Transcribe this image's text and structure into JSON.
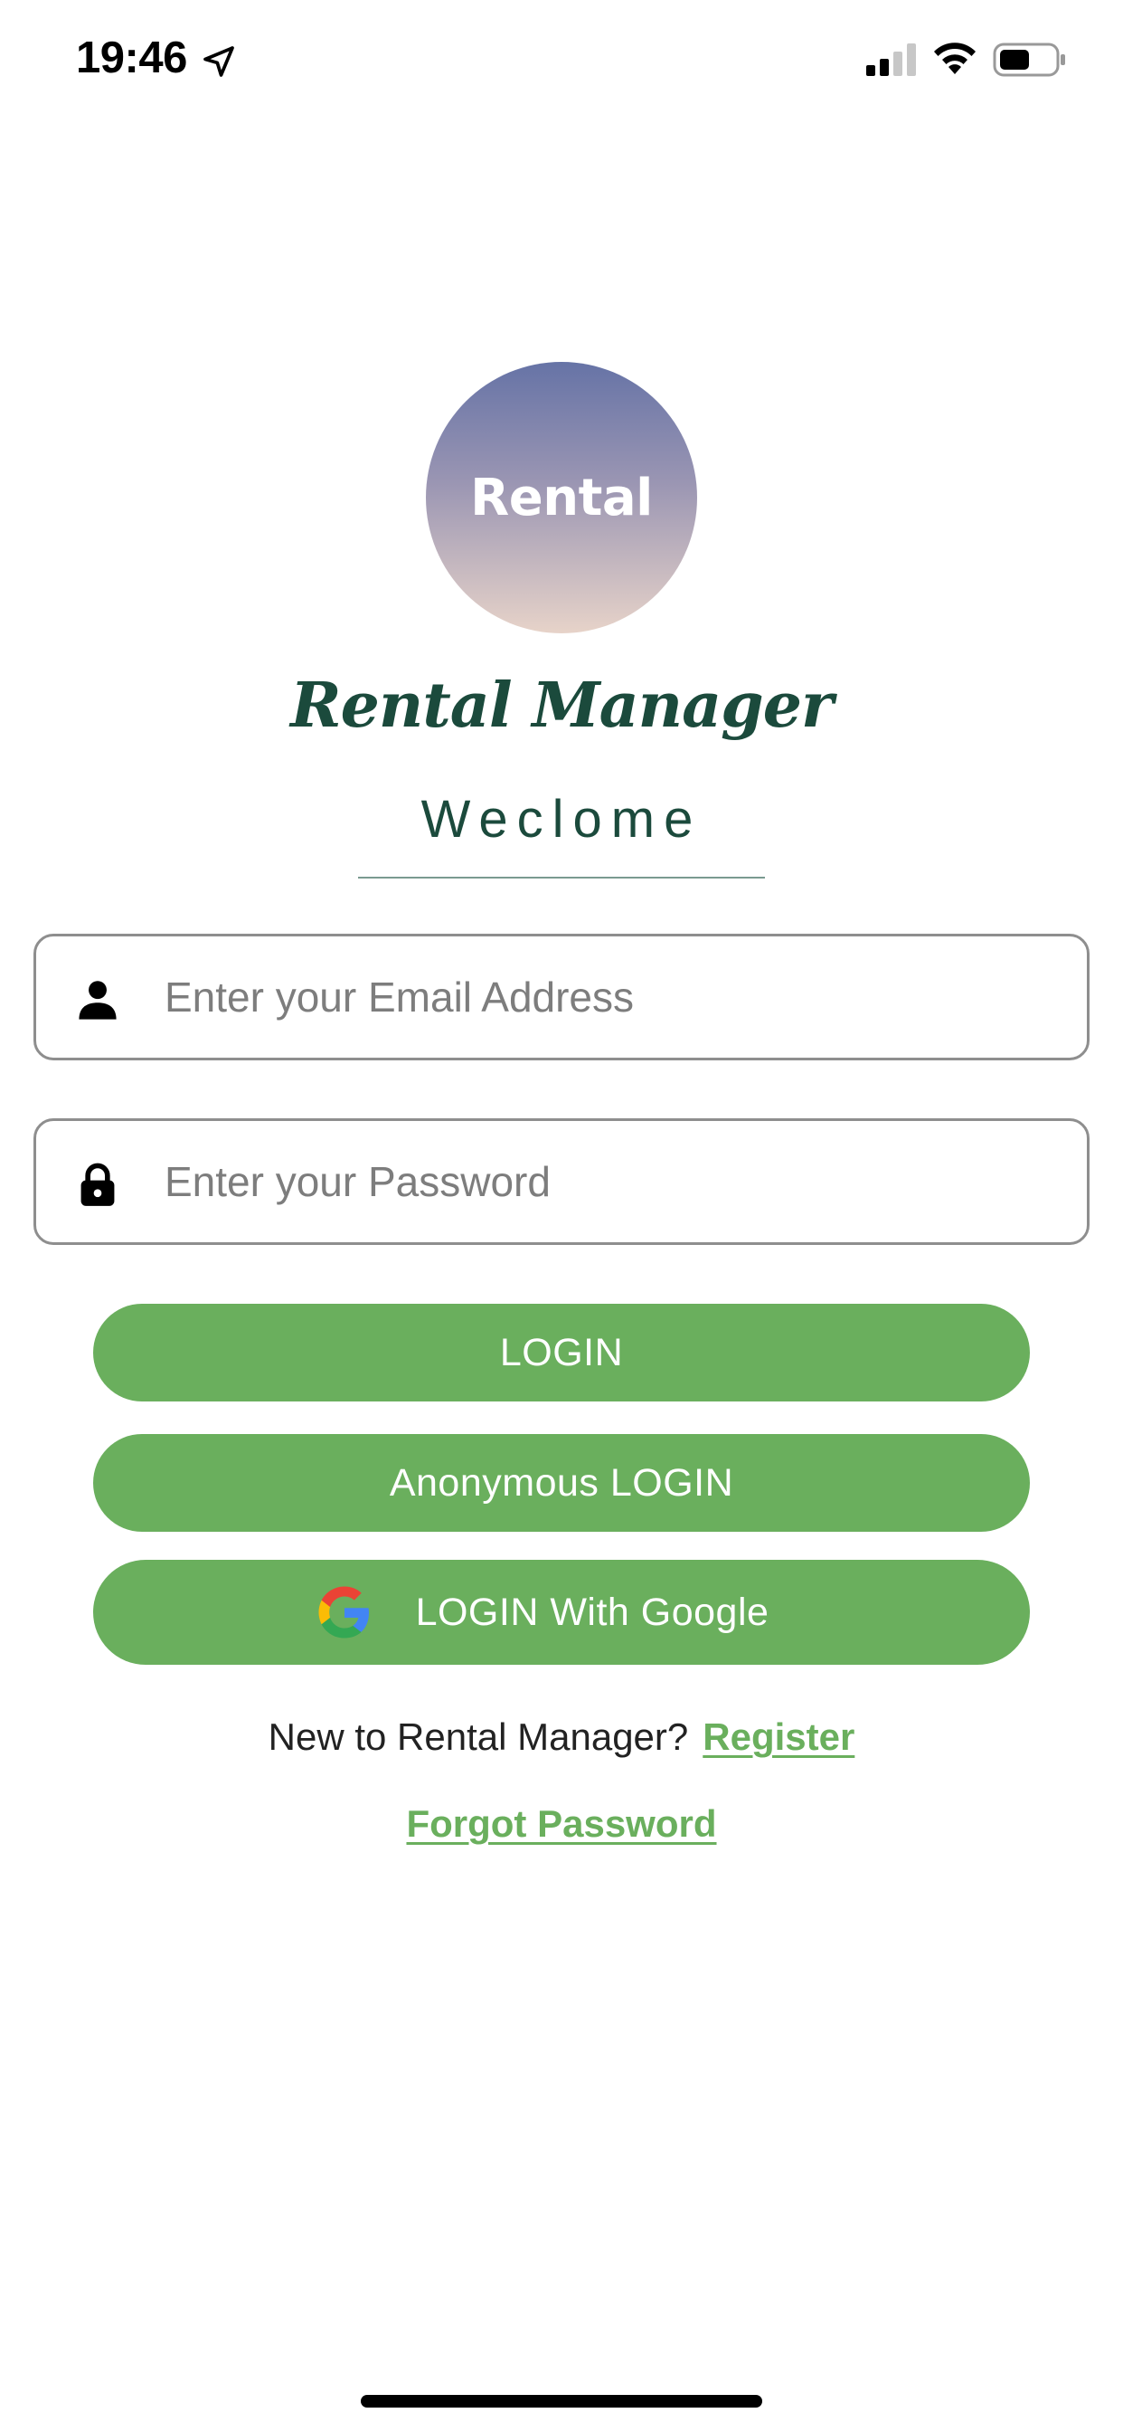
{
  "status_bar": {
    "time": "19:46",
    "icons": [
      "location-arrow-icon",
      "cellular-signal-icon",
      "wifi-icon",
      "battery-icon"
    ]
  },
  "logo": {
    "text": "Rental",
    "gradient_colors": [
      "#6673a6",
      "#e7d3c9"
    ]
  },
  "app_title": "Rental Manager",
  "welcome": "Weclome",
  "form": {
    "email": {
      "icon": "person-icon",
      "value": "",
      "placeholder": "Enter your Email Address"
    },
    "password": {
      "icon": "lock-icon",
      "value": "",
      "placeholder": "Enter your Password"
    }
  },
  "buttons": {
    "login": "LOGIN",
    "anonymous_login": "Anonymous LOGIN",
    "google_login": "LOGIN With Google",
    "google_icon": "google-g-icon"
  },
  "links": {
    "register_prompt": "New to Rental Manager?",
    "register": "Register",
    "forgot_password": "Forgot Password"
  },
  "colors": {
    "accent_green": "#6aaf5d",
    "title_green": "#1b4a3c",
    "field_border": "#8e8e8e"
  }
}
